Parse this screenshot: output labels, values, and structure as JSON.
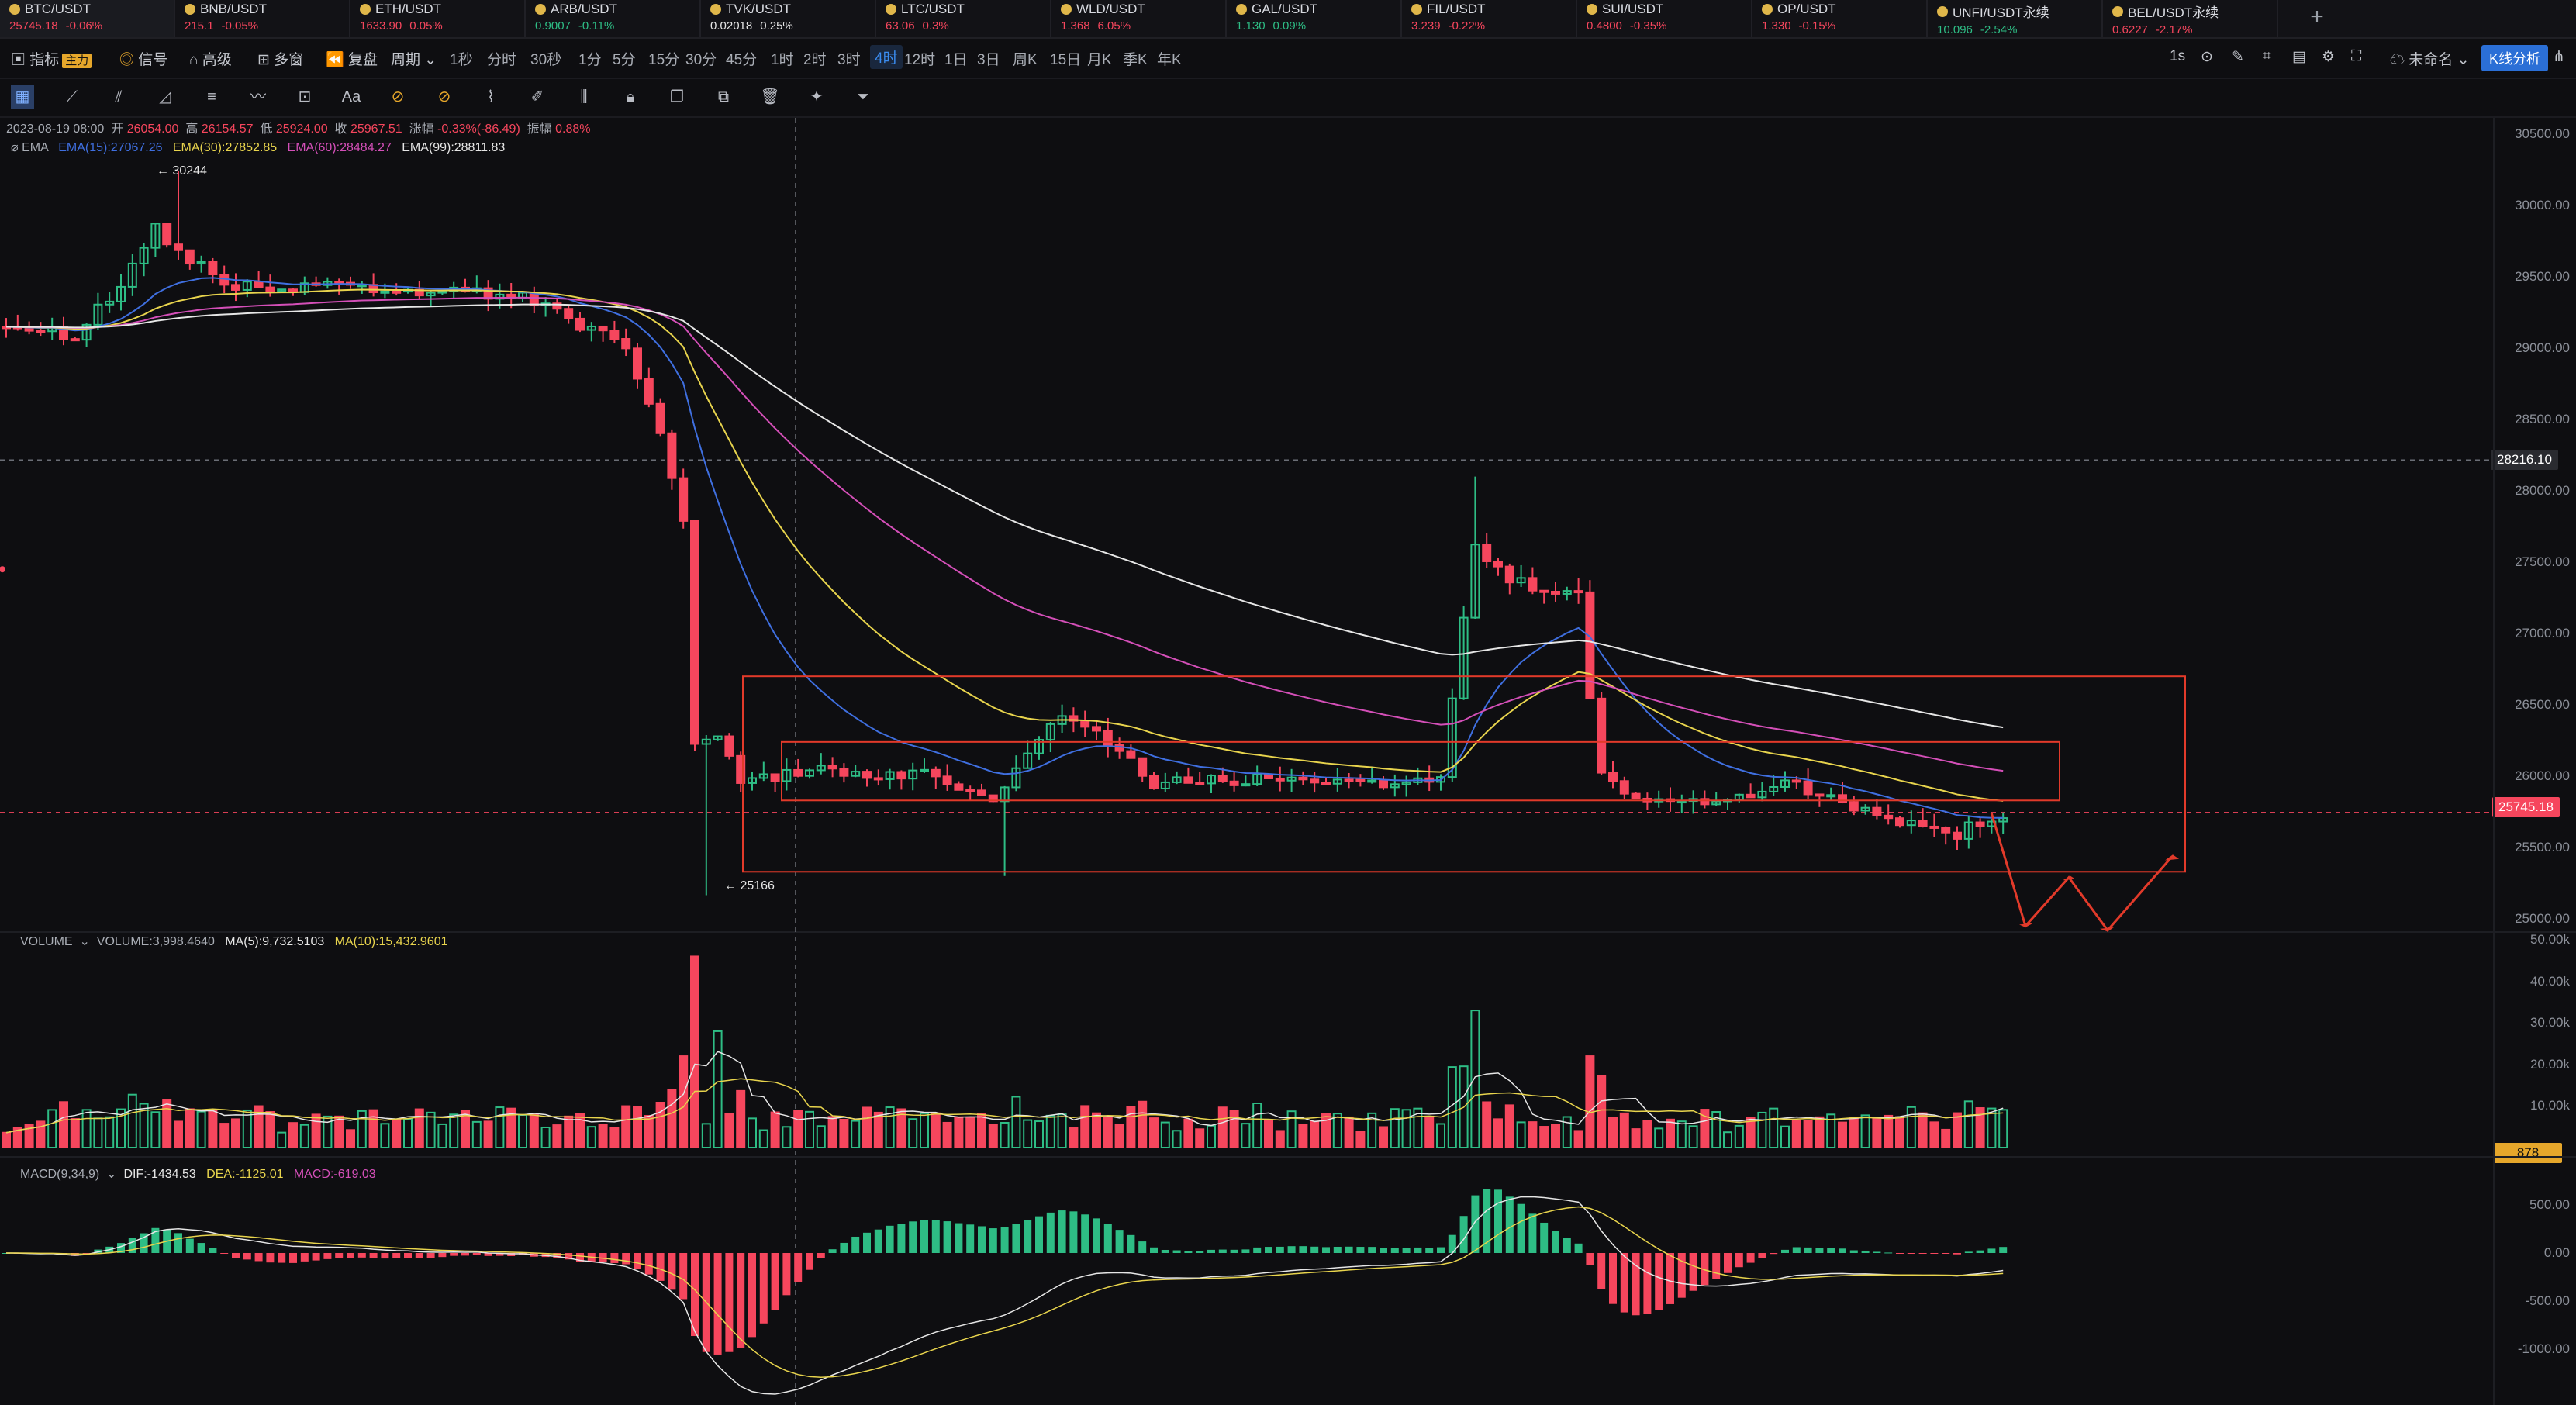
{
  "tickers": [
    {
      "symbol": "BTC/USDT",
      "price": "25745.18",
      "change": "-0.06%",
      "up": false,
      "active": true
    },
    {
      "symbol": "BNB/USDT",
      "price": "215.1",
      "change": "-0.05%",
      "up": false
    },
    {
      "symbol": "ETH/USDT",
      "price": "1633.90",
      "change": "0.05%",
      "up": false
    },
    {
      "symbol": "ARB/USDT",
      "price": "0.9007",
      "change": "-0.11%",
      "up": true
    },
    {
      "symbol": "TVK/USDT",
      "price": "0.02018",
      "change": "0.25%",
      "up": null
    },
    {
      "symbol": "LTC/USDT",
      "price": "63.06",
      "change": "0.3%",
      "up": false
    },
    {
      "symbol": "WLD/USDT",
      "price": "1.368",
      "change": "6.05%",
      "up": false
    },
    {
      "symbol": "GAL/USDT",
      "price": "1.130",
      "change": "0.09%",
      "up": true
    },
    {
      "symbol": "FIL/USDT",
      "price": "3.239",
      "change": "-0.22%",
      "up": false
    },
    {
      "symbol": "SUI/USDT",
      "price": "0.4800",
      "change": "-0.35%",
      "up": false
    },
    {
      "symbol": "OP/USDT",
      "price": "1.330",
      "change": "-0.15%",
      "up": false
    },
    {
      "symbol": "UNFI/USDT永续",
      "price": "10.096",
      "change": "-2.54%",
      "up": true
    },
    {
      "symbol": "BEL/USDT永续",
      "price": "0.6227",
      "change": "-2.17%",
      "up": false
    }
  ],
  "add_tab": "+",
  "toolbar": {
    "indicators": "指标",
    "main_badge": "主力",
    "signal": "信号",
    "advanced": "高级",
    "multi": "多窗",
    "replay": "复盘",
    "period": "周期",
    "intervals": [
      "1秒",
      "分时",
      "30秒",
      "1分",
      "5分",
      "15分",
      "30分",
      "45分",
      "1时",
      "2时",
      "3时",
      "4时",
      "12时",
      "1日",
      "3日",
      "周K",
      "15日",
      "月K",
      "季K",
      "年K"
    ],
    "selected_interval": "4时",
    "right_interval": "1s",
    "unnamed": "未命名",
    "kline_analysis": "K线分析"
  },
  "ohlc": {
    "date": "2023-08-19 08:00",
    "open_label": "开",
    "open": "26054.00",
    "high_label": "高",
    "high": "26154.57",
    "low_label": "低",
    "low": "25924.00",
    "close_label": "收",
    "close": "25967.51",
    "change_label": "涨幅",
    "change": "-0.33%(-86.49)",
    "amp_label": "振幅",
    "amp": "0.88%"
  },
  "ema_legend": {
    "name": "EMA",
    "e15": "EMA(15):27067.26",
    "e30": "EMA(30):27852.85",
    "e60": "EMA(60):28484.27",
    "e99": "EMA(99):28811.83"
  },
  "volume_legend": {
    "name": "VOLUME",
    "vol": "VOLUME:3,998.4640",
    "ma5": "MA(5):9,732.5103",
    "ma10": "MA(10):15,432.9601"
  },
  "macd_legend": {
    "name": "MACD(9,34,9)",
    "dif": "DIF:-1434.53",
    "dea": "DEA:-1125.01",
    "macd": "MACD:-619.03"
  },
  "annotations": {
    "high": "← 30244",
    "low": "← 25166"
  },
  "price_axis": [
    "30500.00",
    "30000.00",
    "29500.00",
    "29000.00",
    "28500.00",
    "28000.00",
    "27500.00",
    "27000.00",
    "26500.00",
    "26000.00",
    "25500.00",
    "25000.00"
  ],
  "crosshair_price": "28216.10",
  "last_price": "25745.18",
  "volume_axis": [
    "50.00k",
    "40.00k",
    "30.00k",
    "20.00k",
    "10.00k"
  ],
  "volume_last": "878",
  "macd_axis": [
    "500.00",
    "0.00",
    "-500.00",
    "-1000.00"
  ],
  "colors": {
    "up": "#2ebd85",
    "down": "#f6465d",
    "ema15": "#3f6fe0",
    "ema30": "#e8d44d",
    "ema60": "#d44fb8",
    "ema99": "#e6e6e6",
    "accent": "#2b6fd6"
  },
  "chart_data": {
    "type": "candlestick",
    "series": [
      {
        "name": "EMA(15)",
        "value": 27067.26
      },
      {
        "name": "EMA(30)",
        "value": 27852.85
      },
      {
        "name": "EMA(60)",
        "value": 28484.27
      },
      {
        "name": "EMA(99)",
        "value": 28811.83
      }
    ],
    "ylim": [
      24900,
      30600
    ],
    "grid": true
  }
}
